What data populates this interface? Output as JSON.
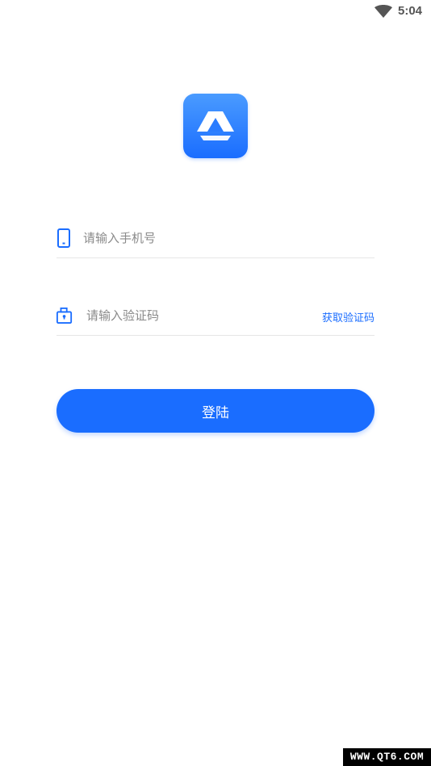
{
  "status_bar": {
    "time": "5:04",
    "wifi_icon": "wifi-icon"
  },
  "logo": {
    "icon": "app-logo-icon",
    "bg_color": "#1a6dff"
  },
  "phone_field": {
    "placeholder": "请输入手机号",
    "value": "",
    "icon": "phone-icon"
  },
  "code_field": {
    "placeholder": "请输入验证码",
    "value": "",
    "icon": "lock-icon",
    "get_code_label": "获取验证码"
  },
  "login_button": {
    "label": "登陆",
    "color": "#1a6dff"
  },
  "watermark": {
    "text": "WWW.QT6.COM"
  }
}
